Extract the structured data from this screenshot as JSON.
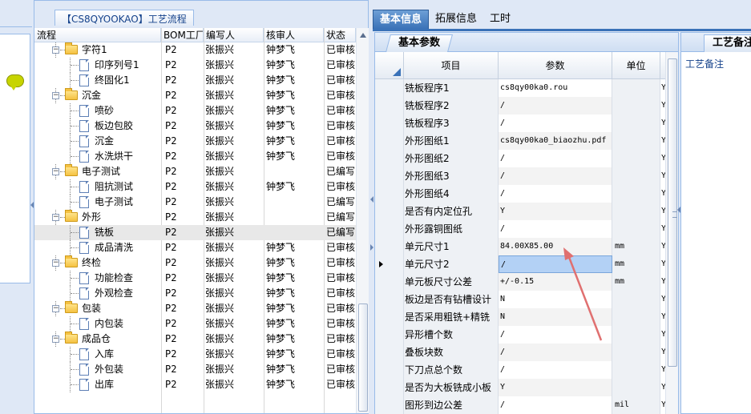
{
  "tree_panel": {
    "title": "【CS8QYOOKAO】工艺流程",
    "columns": [
      "流程",
      "BOM工厂",
      "编写人",
      "核审人",
      "状态"
    ],
    "rows": [
      {
        "name": "字符1",
        "level": 1,
        "type": "folder",
        "bom": "P2",
        "author": "张振兴",
        "reviewer": "钟梦飞",
        "status": "已审核"
      },
      {
        "name": "印序列号1",
        "level": 2,
        "type": "doc",
        "bom": "P2",
        "author": "张振兴",
        "reviewer": "钟梦飞",
        "status": "已审核"
      },
      {
        "name": "终固化1",
        "level": 2,
        "type": "doc",
        "bom": "P2",
        "author": "张振兴",
        "reviewer": "钟梦飞",
        "status": "已审核"
      },
      {
        "name": "沉金",
        "level": 1,
        "type": "folder",
        "bom": "P2",
        "author": "张振兴",
        "reviewer": "钟梦飞",
        "status": "已审核"
      },
      {
        "name": "喷砂",
        "level": 2,
        "type": "doc",
        "bom": "P2",
        "author": "张振兴",
        "reviewer": "钟梦飞",
        "status": "已审核"
      },
      {
        "name": "板边包胶",
        "level": 2,
        "type": "doc",
        "bom": "P2",
        "author": "张振兴",
        "reviewer": "钟梦飞",
        "status": "已审核"
      },
      {
        "name": "沉金",
        "level": 2,
        "type": "doc",
        "bom": "P2",
        "author": "张振兴",
        "reviewer": "钟梦飞",
        "status": "已审核"
      },
      {
        "name": "水洗烘干",
        "level": 2,
        "type": "doc",
        "bom": "P2",
        "author": "张振兴",
        "reviewer": "钟梦飞",
        "status": "已审核"
      },
      {
        "name": "电子测试",
        "level": 1,
        "type": "folder",
        "bom": "P2",
        "author": "张振兴",
        "reviewer": "",
        "status": "已编写"
      },
      {
        "name": "阻抗测试",
        "level": 2,
        "type": "doc",
        "bom": "P2",
        "author": "张振兴",
        "reviewer": "钟梦飞",
        "status": "已审核"
      },
      {
        "name": "电子测试",
        "level": 2,
        "type": "doc",
        "bom": "P2",
        "author": "张振兴",
        "reviewer": "",
        "status": "已编写"
      },
      {
        "name": "外形",
        "level": 1,
        "type": "folder",
        "bom": "P2",
        "author": "张振兴",
        "reviewer": "",
        "status": "已编写"
      },
      {
        "name": "铣板",
        "level": 2,
        "type": "doc",
        "bom": "P2",
        "author": "张振兴",
        "reviewer": "",
        "status": "已编写",
        "selected": true
      },
      {
        "name": "成品清洗",
        "level": 2,
        "type": "doc",
        "bom": "P2",
        "author": "张振兴",
        "reviewer": "钟梦飞",
        "status": "已审核"
      },
      {
        "name": "终检",
        "level": 1,
        "type": "folder",
        "bom": "P2",
        "author": "张振兴",
        "reviewer": "钟梦飞",
        "status": "已审核"
      },
      {
        "name": "功能检查",
        "level": 2,
        "type": "doc",
        "bom": "P2",
        "author": "张振兴",
        "reviewer": "钟梦飞",
        "status": "已审核"
      },
      {
        "name": "外观检查",
        "level": 2,
        "type": "doc",
        "bom": "P2",
        "author": "张振兴",
        "reviewer": "钟梦飞",
        "status": "已审核"
      },
      {
        "name": "包装",
        "level": 1,
        "type": "folder",
        "bom": "P2",
        "author": "张振兴",
        "reviewer": "钟梦飞",
        "status": "已审核"
      },
      {
        "name": "内包装",
        "level": 2,
        "type": "doc",
        "bom": "P2",
        "author": "张振兴",
        "reviewer": "钟梦飞",
        "status": "已审核"
      },
      {
        "name": "成品仓",
        "level": 1,
        "type": "folder",
        "bom": "P2",
        "author": "张振兴",
        "reviewer": "钟梦飞",
        "status": "已审核"
      },
      {
        "name": "入库",
        "level": 2,
        "type": "doc",
        "bom": "P2",
        "author": "张振兴",
        "reviewer": "钟梦飞",
        "status": "已审核"
      },
      {
        "name": "外包装",
        "level": 2,
        "type": "doc",
        "bom": "P2",
        "author": "张振兴",
        "reviewer": "钟梦飞",
        "status": "已审核"
      },
      {
        "name": "出库",
        "level": 2,
        "type": "doc",
        "bom": "P2",
        "author": "张振兴",
        "reviewer": "钟梦飞",
        "status": "已审核"
      }
    ]
  },
  "tabs": [
    {
      "label": "基本信息",
      "active": true
    },
    {
      "label": "拓展信息",
      "active": false
    },
    {
      "label": "工时",
      "active": false
    }
  ],
  "basic_params": {
    "subtab_label": "基本参数",
    "columns": {
      "item": "项目",
      "param": "参数",
      "unit": "单位"
    },
    "rows": [
      {
        "item": "铣板程序1",
        "param": "cs8qy00ka0.rou",
        "unit": "",
        "flag": "Y"
      },
      {
        "item": "铣板程序2",
        "param": "/",
        "unit": "",
        "flag": "Y"
      },
      {
        "item": "铣板程序3",
        "param": "/",
        "unit": "",
        "flag": "Y"
      },
      {
        "item": "外形图纸1",
        "param": "cs8qy00ka0_biaozhu.pdf",
        "unit": "",
        "flag": "Y"
      },
      {
        "item": "外形图纸2",
        "param": "/",
        "unit": "",
        "flag": "Y"
      },
      {
        "item": "外形图纸3",
        "param": "/",
        "unit": "",
        "flag": "Y"
      },
      {
        "item": "外形图纸4",
        "param": "/",
        "unit": "",
        "flag": "Y"
      },
      {
        "item": "是否有内定位孔",
        "param": "Y",
        "unit": "",
        "flag": "Y"
      },
      {
        "item": "外形露铜图纸",
        "param": "/",
        "unit": "",
        "flag": "Y"
      },
      {
        "item": "单元尺寸1",
        "param": "84.00X85.00",
        "unit": "mm",
        "flag": "Y"
      },
      {
        "item": "单元尺寸2",
        "param": "/",
        "unit": "mm",
        "flag": "Y",
        "current": true
      },
      {
        "item": "单元板尺寸公差",
        "param": "+/-0.15",
        "unit": "mm",
        "flag": "Y"
      },
      {
        "item": "板边是否有钻槽设计",
        "param": "N",
        "unit": "",
        "flag": "Y"
      },
      {
        "item": "是否采用粗铣+精铣",
        "param": "N",
        "unit": "",
        "flag": "Y"
      },
      {
        "item": "异形槽个数",
        "param": "/",
        "unit": "",
        "flag": "Y"
      },
      {
        "item": "叠板块数",
        "param": "/",
        "unit": "",
        "flag": "Y"
      },
      {
        "item": "下刀点总个数",
        "param": "/",
        "unit": "",
        "flag": "Y"
      },
      {
        "item": "是否为大板铣成小板",
        "param": "Y",
        "unit": "",
        "flag": "Y"
      },
      {
        "item": "图形到边公差",
        "param": "/",
        "unit": "mil",
        "flag": "Y"
      }
    ]
  },
  "notes_panel": {
    "tab_label": "工艺备注",
    "field_label": "工艺备注"
  },
  "colors": {
    "accent": "#3a72b8",
    "panel_border": "#99bbe8",
    "annotation_arrow": "#e07070"
  },
  "icons": [
    "chat-bubble-icon",
    "folder-icon",
    "document-icon",
    "expander-minus-icon",
    "scroll-up-arrow-icon",
    "row-pointer-icon"
  ]
}
